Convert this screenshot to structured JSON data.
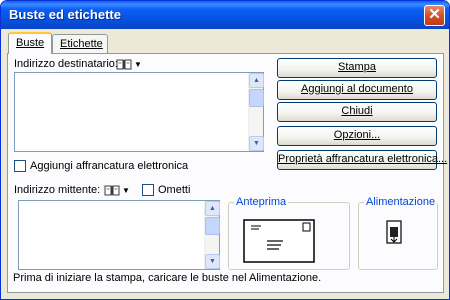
{
  "window": {
    "title": "Buste ed etichette",
    "close_glyph": "✕"
  },
  "tabs": [
    {
      "label": "Buste"
    },
    {
      "label": "Etichette"
    }
  ],
  "recipient": {
    "label": "Indirizzo destinatario:",
    "value": ""
  },
  "sender": {
    "label": "Indirizzo mittente:",
    "value": "",
    "omit_label": "Ometti"
  },
  "postage": {
    "label": "Aggiungi affrancatura elettronica"
  },
  "buttons": {
    "print": "Stampa",
    "add_to_document": "Aggiungi al documento",
    "close": "Chiudi",
    "options": "Opzioni...",
    "postage_properties": "Proprietà affrancatura elettronica..."
  },
  "preview": {
    "label": "Anteprima"
  },
  "feed": {
    "label": "Alimentazione"
  },
  "status": {
    "text": "Prima di iniziare la stampa, caricare le buste nel Alimentazione."
  },
  "icons": {
    "address_book": "address-book-icon",
    "dropdown": "chevron-down-icon",
    "scroll_up": "▲",
    "scroll_down": "▼"
  }
}
